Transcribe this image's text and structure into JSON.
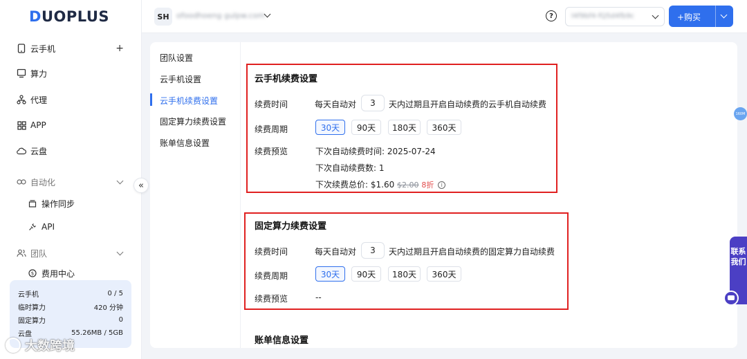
{
  "brand": {
    "logo_initial": "D",
    "logo_rest": "UOPLUS",
    "accent_color": "#2f6fed"
  },
  "sidebar": {
    "items": [
      {
        "label": "云手机",
        "icon": "phone-icon",
        "right": "+"
      },
      {
        "label": "算力",
        "icon": "monitor-icon"
      },
      {
        "label": "代理",
        "icon": "network-icon"
      },
      {
        "label": "APP",
        "icon": "grid-icon"
      },
      {
        "label": "云盘",
        "icon": "cloud-icon"
      }
    ],
    "automation": {
      "label": "自动化",
      "icon": "link-icon"
    },
    "automation_children": [
      {
        "label": "操作同步",
        "icon": "stack-icon"
      },
      {
        "label": "API",
        "icon": "plug-icon"
      }
    ],
    "team": {
      "label": "团队",
      "icon": "users-icon"
    },
    "team_children": [
      {
        "label": "费用中心",
        "icon": "dollar-icon"
      }
    ],
    "collapse_icon": "«",
    "usage": [
      {
        "label": "云手机",
        "value": "0 / 5"
      },
      {
        "label": "临时算力",
        "value": "420 分钟"
      },
      {
        "label": "固定算力",
        "value": "0"
      },
      {
        "label": "云盘",
        "value": "55.26MB / 5GB"
      }
    ]
  },
  "watermark": {
    "text": "大数跨境"
  },
  "header": {
    "team_badge": "SH",
    "team_name": "ofoodhoeng gulpw.com",
    "help_icon": "?",
    "account_text": "l4f9bf4-fQ5d4fb9c",
    "buy_label": "+购买"
  },
  "subnav": {
    "items": [
      "团队设置",
      "云手机设置",
      "云手机续费设置",
      "固定算力续费设置",
      "账单信息设置"
    ],
    "active_index": 2
  },
  "cloud_phone_renewal": {
    "title": "云手机续费设置",
    "time_label": "续费时间",
    "time_prefix": "每天自动对",
    "days": "3",
    "time_suffix": "天内过期且开启自动续费的云手机自动续费",
    "period_label": "续费周期",
    "periods": [
      "30天",
      "90天",
      "180天",
      "360天"
    ],
    "selected_period": "30天",
    "preview_label": "续费预览",
    "next_time": "下次自动续费时间: 2025-07-24",
    "next_count": "下次自动续费数: 1",
    "total_prefix": "下次续费总价: $1.60",
    "original_price": "$2.00",
    "discount": "8折",
    "info_icon": "i"
  },
  "fixed_compute_renewal": {
    "title": "固定算力续费设置",
    "time_label": "续费时间",
    "time_prefix": "每天自动对",
    "days": "3",
    "time_suffix": "天内过期且开启自动续费的固定算力自动续费",
    "period_label": "续费周期",
    "periods": [
      "30天",
      "90天",
      "180天",
      "360天"
    ],
    "selected_period": "30天",
    "preview_label": "续费预览",
    "preview_value": "--"
  },
  "billing_settings": {
    "title": "账单信息设置"
  },
  "right_float": {
    "badge": "160M",
    "contact_label": "联系我们"
  }
}
